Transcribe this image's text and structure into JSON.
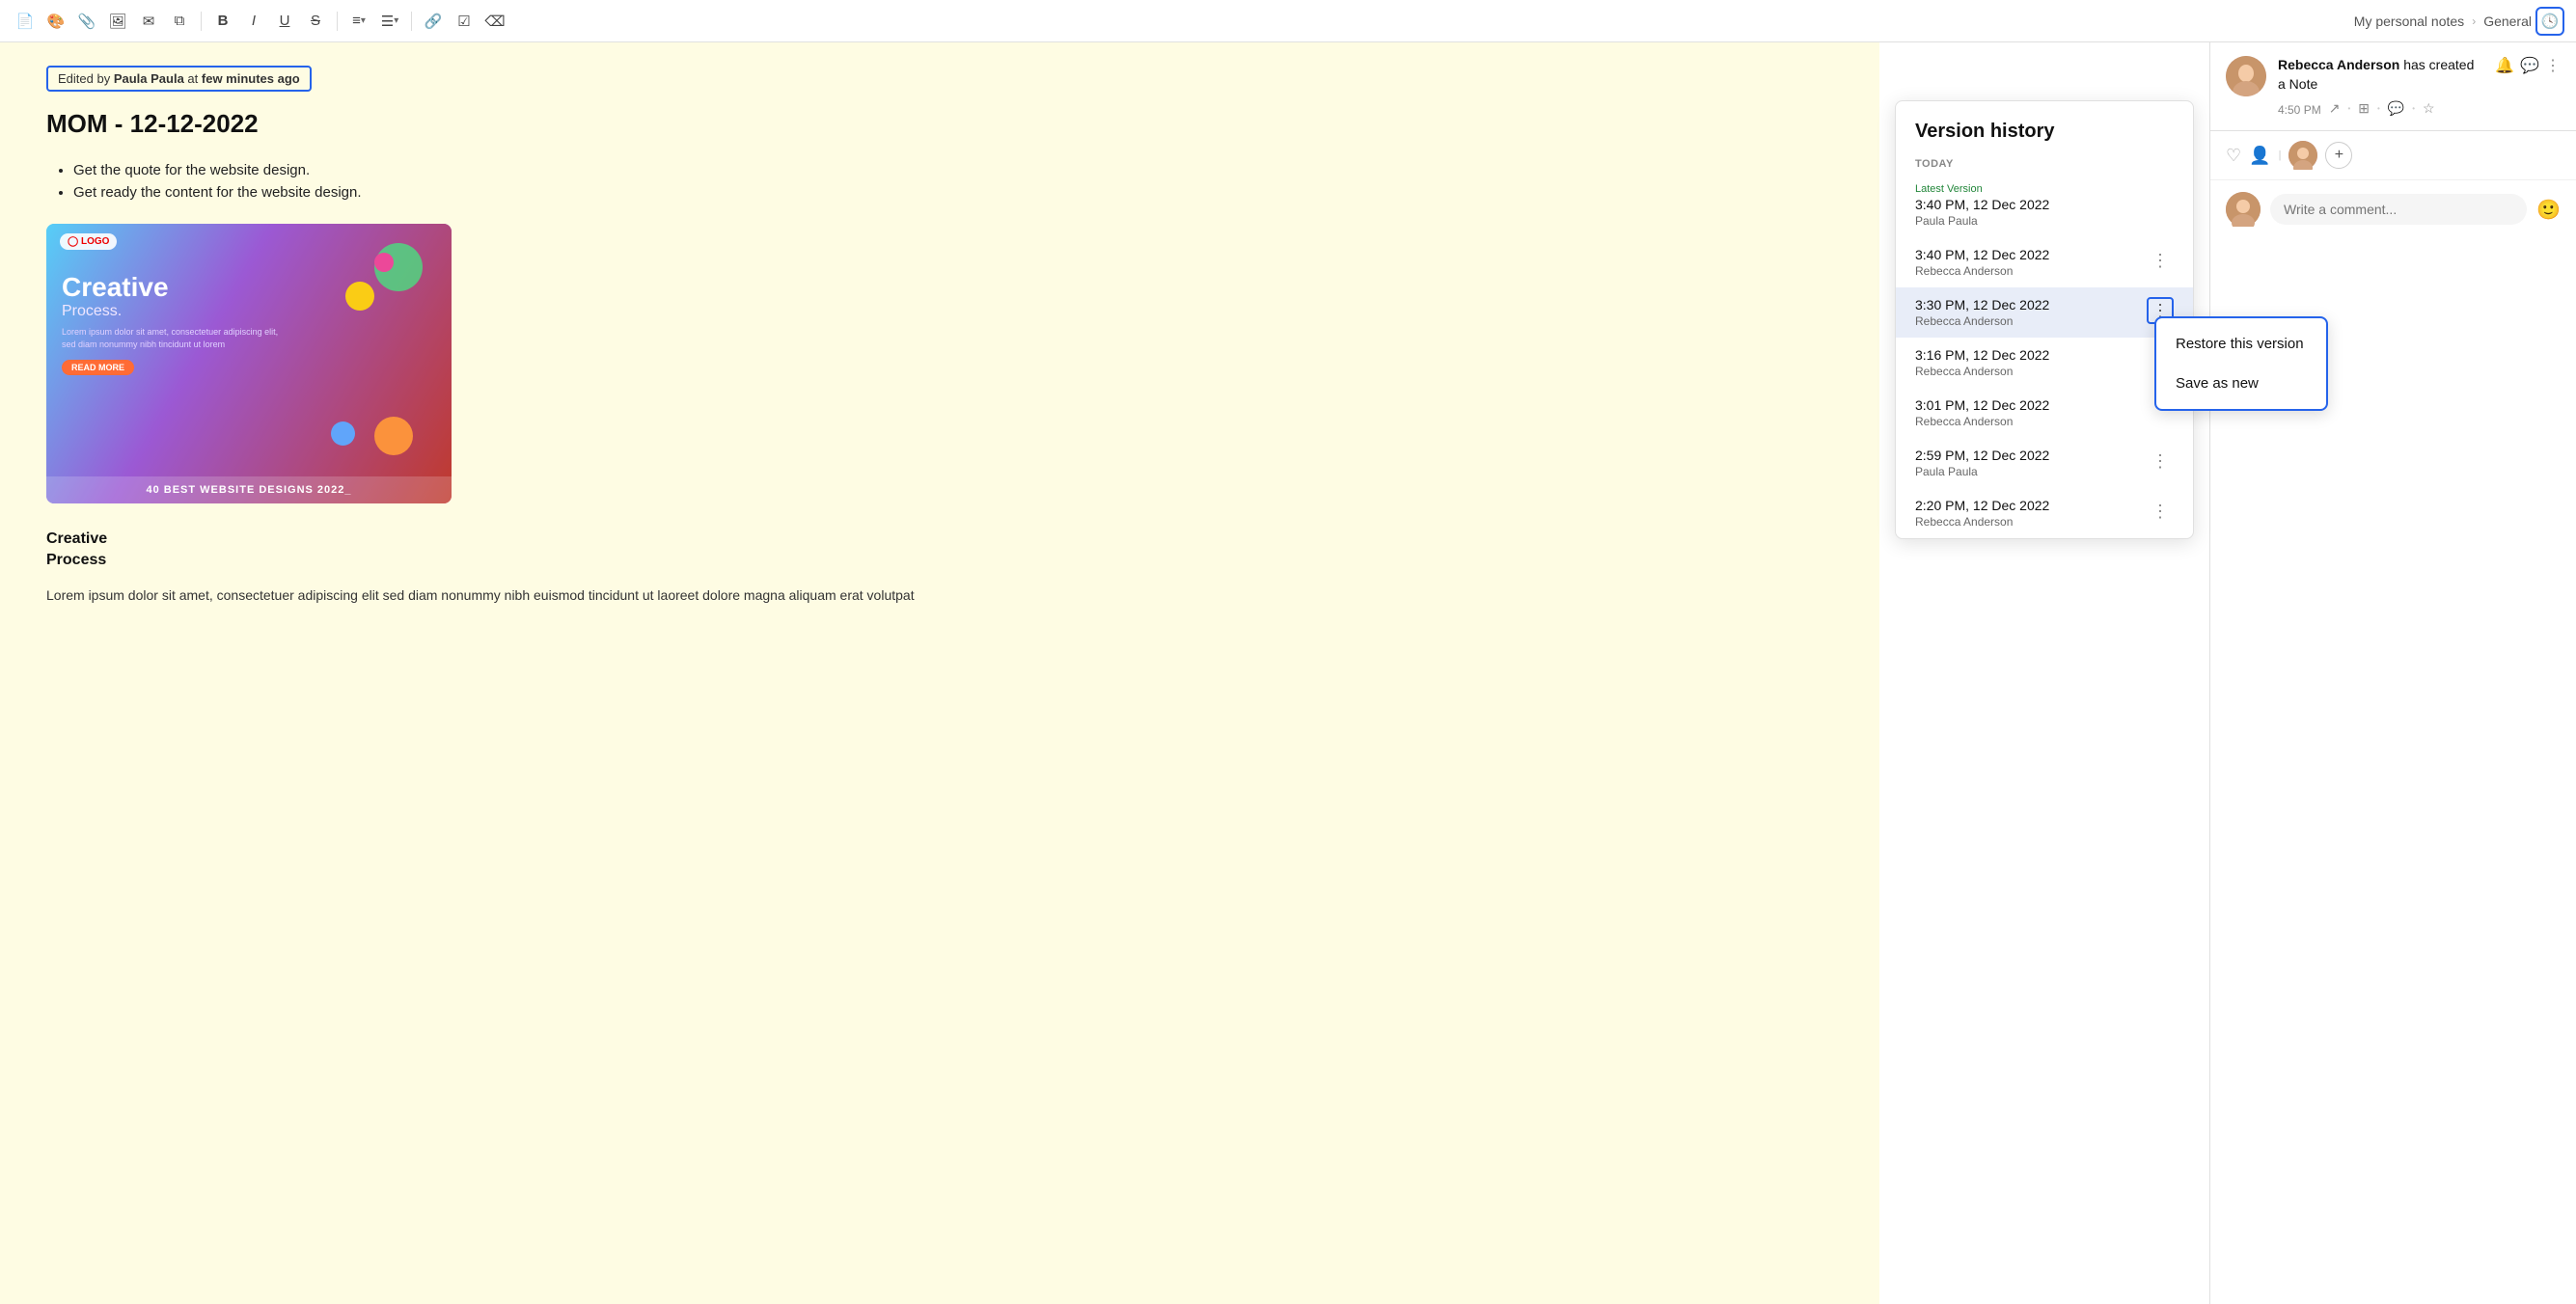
{
  "toolbar": {
    "icons": [
      {
        "name": "page-icon",
        "symbol": "📄"
      },
      {
        "name": "palette-icon",
        "symbol": "🎨"
      },
      {
        "name": "attachment-icon",
        "symbol": "📎"
      },
      {
        "name": "image-icon",
        "symbol": "🖼"
      },
      {
        "name": "send-icon",
        "symbol": "✉"
      },
      {
        "name": "embed-icon",
        "symbol": "⧉"
      },
      {
        "name": "bold-icon",
        "symbol": "B"
      },
      {
        "name": "italic-icon",
        "symbol": "I"
      },
      {
        "name": "underline-icon",
        "symbol": "U"
      },
      {
        "name": "strikethrough-icon",
        "symbol": "S"
      },
      {
        "name": "align-icon",
        "symbol": "≡"
      },
      {
        "name": "list-icon",
        "symbol": "☰"
      },
      {
        "name": "link-icon",
        "symbol": "🔗"
      },
      {
        "name": "checkbox-icon",
        "symbol": "☑"
      },
      {
        "name": "eraser-icon",
        "symbol": "⌫"
      }
    ],
    "breadcrumb": {
      "note": "My personal notes",
      "section": "General"
    },
    "history_btn_label": "🕓"
  },
  "edited_badge": {
    "prefix": "Edited by ",
    "author": "Paula Paula",
    "suffix": " at ",
    "time": "few minutes ago"
  },
  "doc": {
    "title": "MOM - 12-12-2022",
    "bullets": [
      "Get the quote for the website design.",
      "Get ready the content for the website design."
    ],
    "image": {
      "logo": "◯ LOGO",
      "big_text": "Creative",
      "sub_text": "Process.",
      "footer": "40 BEST WEBSITE DESIGNS 2022_"
    },
    "section1": "Creative",
    "section2": "Process",
    "paragraph": "Lorem ipsum dolor sit amet, consectetuer adipiscing elit sed diam nonummy nibh euismod tincidunt ut laoreet dolore magna aliquam erat volutpat"
  },
  "version_panel": {
    "title": "Version history",
    "section_label": "TODAY",
    "versions": [
      {
        "id": "v1",
        "latest_label": "Latest Version",
        "time": "3:40 PM, 12 Dec 2022",
        "author": "Paula Paula",
        "selected": false,
        "show_menu": false
      },
      {
        "id": "v2",
        "latest_label": "",
        "time": "3:40 PM, 12 Dec 2022",
        "author": "Rebecca Anderson",
        "selected": false,
        "show_menu": true
      },
      {
        "id": "v3",
        "latest_label": "",
        "time": "3:30 PM, 12 Dec 2022",
        "author": "Rebecca Anderson",
        "selected": true,
        "show_menu": true,
        "context_menu_open": true
      },
      {
        "id": "v4",
        "latest_label": "",
        "time": "3:16 PM, 12 Dec 2022",
        "author": "Rebecca Anderson",
        "selected": false,
        "show_menu": false
      },
      {
        "id": "v5",
        "latest_label": "",
        "time": "3:01 PM, 12 Dec 2022",
        "author": "Rebecca Anderson",
        "selected": false,
        "show_menu": false
      },
      {
        "id": "v6",
        "latest_label": "",
        "time": "2:59 PM, 12 Dec 2022",
        "author": "Paula Paula",
        "selected": false,
        "show_menu": true
      },
      {
        "id": "v7",
        "latest_label": "",
        "time": "2:20 PM, 12 Dec 2022",
        "author": "Rebecca Anderson",
        "selected": false,
        "show_menu": true
      }
    ],
    "context_menu": {
      "restore": "Restore this version",
      "save_new": "Save as new"
    }
  },
  "right_sidebar": {
    "notification": {
      "author": "Rebecca Anderson",
      "action": " has created a Note",
      "time": "4:50 PM"
    },
    "comment_placeholder": "Write a comment...",
    "icons": {
      "alarm": "🔔",
      "chat": "💬",
      "more": "⋯",
      "external": "↗",
      "copy": "⊞",
      "chat2": "💬",
      "star": "★"
    }
  }
}
